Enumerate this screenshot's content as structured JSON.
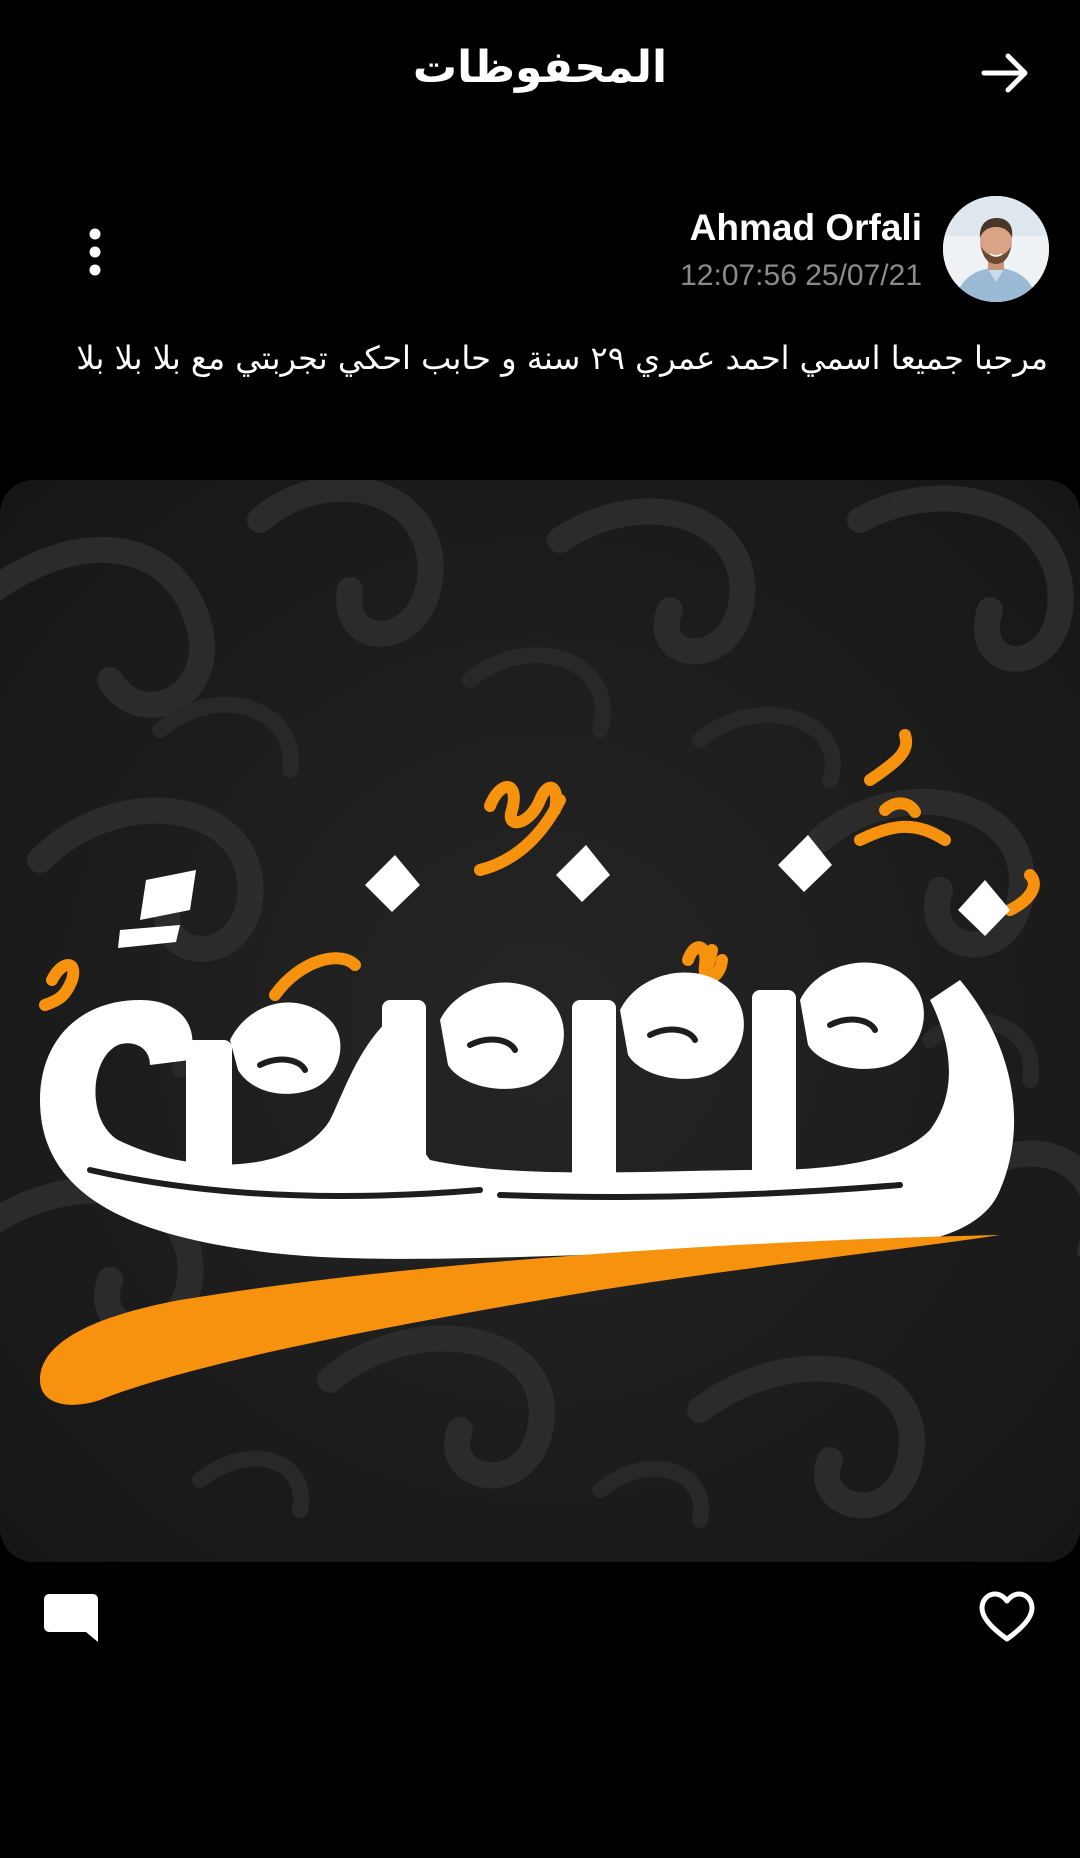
{
  "header": {
    "title": "المحفوظات",
    "back_icon": "arrow-right-icon"
  },
  "post": {
    "author_name": "Ahmad Orfali",
    "timestamp": "12:07:56 25/07/21",
    "text": "مرحبا جميعا اسمي احمد عمري ٢٩ سنة و حابب احكي تجربتي مع بلا بلا بلا",
    "image_caption": "فضفضة",
    "more_icon": "more-vertical-icon",
    "image_description_icon": "post-image"
  },
  "actions": {
    "comment_icon": "comment-icon",
    "like_icon": "heart-icon"
  },
  "colors": {
    "background": "#000000",
    "accent_orange": "#f7920f",
    "secondary_text": "#8b8b8b"
  }
}
